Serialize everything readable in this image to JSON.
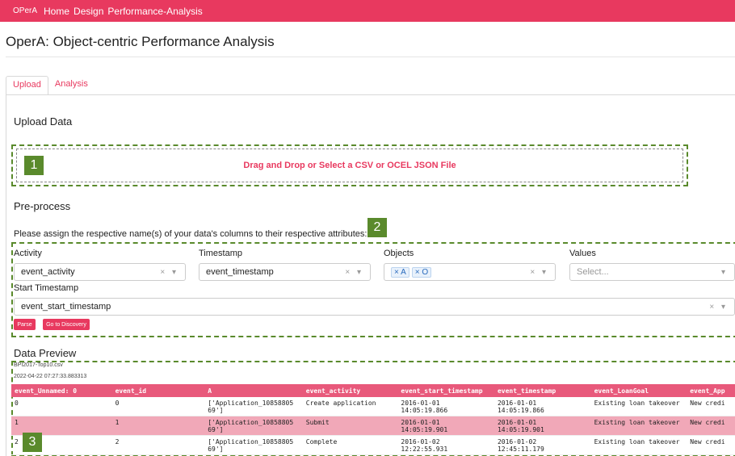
{
  "navbar": {
    "brand": "OPerA",
    "links": [
      "Home",
      "Design",
      "Performance-Analysis"
    ]
  },
  "page_title": "OperA: Object-centric Performance Analysis",
  "tabs": [
    {
      "label": "Upload",
      "active": true
    },
    {
      "label": "Analysis",
      "active": false
    }
  ],
  "upload": {
    "heading": "Upload Data",
    "dropzone_text": "Drag and Drop or Select a CSV or OCEL JSON File",
    "badge": "1"
  },
  "preprocess": {
    "heading": "Pre-process",
    "instruction": "Please assign the respective name(s) of your data's columns to their respective attributes:",
    "badge": "2",
    "activity": {
      "label": "Activity",
      "value": "event_activity"
    },
    "timestamp": {
      "label": "Timestamp",
      "value": "event_timestamp"
    },
    "objects": {
      "label": "Objects",
      "chips": [
        "A",
        "O"
      ]
    },
    "values": {
      "label": "Values",
      "placeholder": "Select..."
    },
    "start_timestamp": {
      "label": "Start Timestamp",
      "value": "event_start_timestamp"
    },
    "parse_button": "Parse",
    "discovery_button": "Go to Discovery"
  },
  "preview": {
    "heading": "Data Preview",
    "file_name": "BPI2017-Top10.csv",
    "file_date": "2022-04-22 07:27:33.883313",
    "badge": "3",
    "columns": [
      "event_Unnamed: 0",
      "event_id",
      "A",
      "event_activity",
      "event_start_timestamp",
      "event_timestamp",
      "event_LoanGoal",
      "event_App"
    ],
    "rows": [
      [
        "0",
        "0",
        "['Application_10858805\n69']",
        "Create application",
        "2016-01-01\n14:05:19.866",
        "2016-01-01\n14:05:19.866",
        "Existing loan takeover",
        "New credi"
      ],
      [
        "1",
        "1",
        "['Application_10858805\n69']",
        "Submit",
        "2016-01-01\n14:05:19.901",
        "2016-01-01\n14:05:19.901",
        "Existing loan takeover",
        "New credi"
      ],
      [
        "2",
        "2",
        "['Application_10858805\n69']",
        "Complete",
        "2016-01-02\n12:22:55.931",
        "2016-01-02\n12:45:11.179",
        "Existing loan takeover",
        "New credi"
      ]
    ]
  },
  "colors": {
    "accent": "#e8395f",
    "annotation": "#5a8a2c"
  },
  "icons": {
    "clear": "×",
    "dropdown": "▾"
  }
}
